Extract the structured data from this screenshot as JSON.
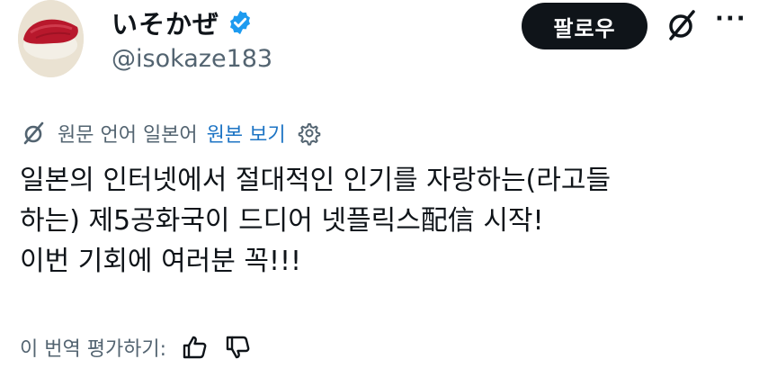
{
  "user": {
    "display_name": "いそかぜ",
    "handle": "@isokaze183",
    "verified": true,
    "verified_color": "#1d9bf0"
  },
  "actions": {
    "follow_label": "팔로우",
    "grok_icon": "grok-slash-icon",
    "more_icon": "more-dots-icon",
    "more_label": "···"
  },
  "translation": {
    "source_text": "원문 언어 일본어",
    "show_original_label": "원본 보기",
    "link_color": "#1d74c4"
  },
  "post": {
    "lines": [
      "일본의 인터넷에서 절대적인 인기를 자랑하는(라고들",
      "하는) 제5공화국이 드디어 넷플릭스配信 시작!",
      "이번 기회에 여러분 꼭!!!"
    ]
  },
  "rating": {
    "label": "이 번역 평가하기:"
  }
}
